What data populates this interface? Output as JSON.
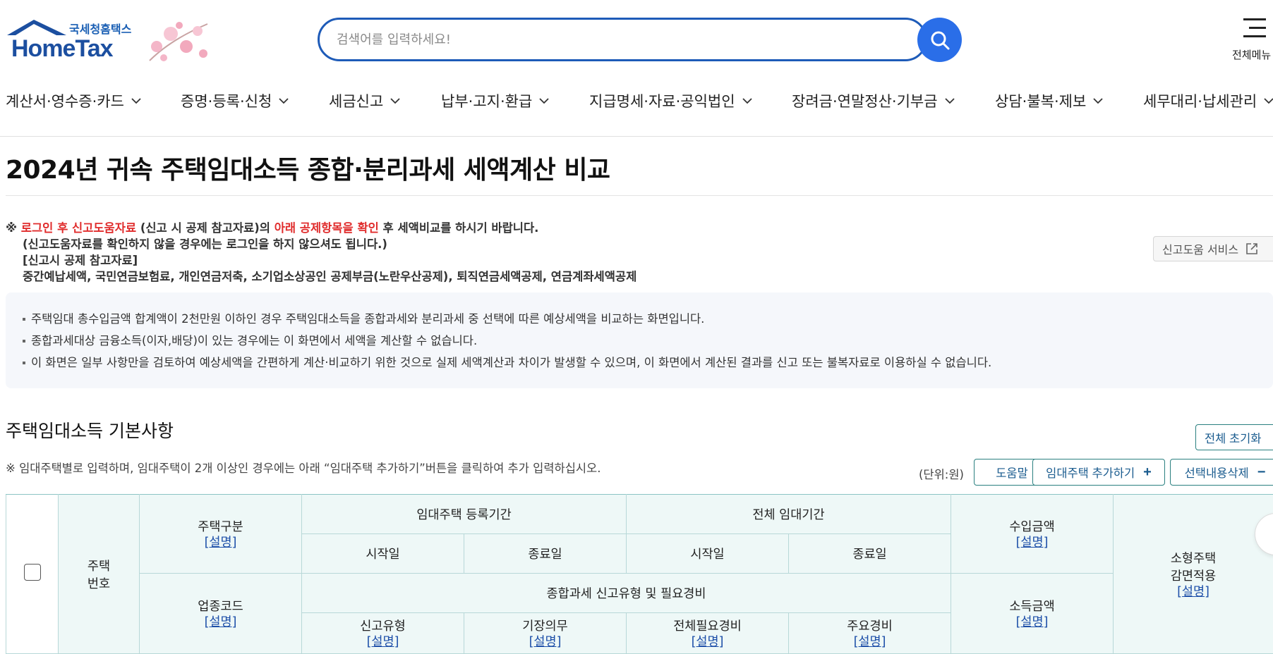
{
  "header": {
    "logo_sub": "국세청홈택스",
    "logo_main": "HomeTax",
    "search_placeholder": "검색어를 입력하세요!",
    "menu_label": "전체메뉴",
    "colors": {
      "brand": "#1c4fa0",
      "search_button": "#2a6ee8",
      "accent_red": "#e02c2c",
      "table_header_bg": "#eef8f7"
    }
  },
  "nav": {
    "items": [
      {
        "label": "계산서·영수증·카드"
      },
      {
        "label": "증명·등록·신청"
      },
      {
        "label": "세금신고"
      },
      {
        "label": "납부·고지·환급"
      },
      {
        "label": "지급명세·자료·공익법인"
      },
      {
        "label": "장려금·연말정산·기부금"
      },
      {
        "label": "상담·불복·제보"
      },
      {
        "label": "세무대리·납세관리"
      }
    ]
  },
  "page_title": "2024년 귀속 주택임대소득 종합·분리과세 세액계산 비교",
  "notice": {
    "mark": "※",
    "red1": "로그인 후 신고도움자료",
    "mid1": " (신고 시 공제 참고자료)의 ",
    "red2": "아래 공제항목을 확인",
    "end1": " 후 세액비교를 하시기 바랍니다.",
    "line2": "(신고도움자료를 확인하지 않을 경우에는 로그인을 하지 않으셔도 됩니다.)",
    "line3": "[신고시 공제 참고자료]",
    "line4": "중간예납세액, 국민연금보험료, 개인연금저축, 소기업소상공인 공제부금(노란우산공제), 퇴직연금세액공제, 연금계좌세액공제"
  },
  "help_service_label": "신고도움 서비스",
  "info_items": [
    "주택임대 총수입금액 합계액이 2천만원 이하인 경우 주택임대소득을 종합과세와 분리과세 중 선택에 따른 예상세액을 비교하는 화면입니다.",
    "종합과세대상 금융소득(이자,배당)이 있는 경우에는 이 화면에서 세액을 계산할 수 없습니다.",
    "이 화면은 일부 사항만을 검토하여 예상세액을 간편하게 계산·비교하기 위한 것으로 실제 세액계산과 차이가 발생할 수 있으며, 이 화면에서 계산된 결과를 신고 또는 불복자료로 이용하실 수 없습니다."
  ],
  "section": {
    "title": "주택임대소득 기본사항",
    "reset_label": "전체 초기화",
    "note": "※ 임대주택별로 입력하며, 임대주택이 2개 이상인 경우에는 아래 “임대주택 추가하기”버튼을 클릭하여 추가 입력하십시오.",
    "unit": "(단위:원)",
    "help_label": "도움말",
    "add_label": "임대주택 추가하기",
    "delete_label": "선택내용삭제"
  },
  "table": {
    "explain": "[설명]",
    "house_no": "주택\n번호",
    "house_type": "주택구분",
    "reg_period": "임대주택 등록기간",
    "total_period": "전체 임대기간",
    "start": "시작일",
    "end": "종료일",
    "income_amount": "수입금액",
    "small_house": "소형주택\n감면적용",
    "industry_code": "업종코드",
    "filing_type_header": "종합과세 신고유형 및 필요경비",
    "filing_type": "신고유형",
    "bookkeeping": "기장의무",
    "total_expense": "전체필요경비",
    "main_expense": "주요경비",
    "earned_amount": "소득금액"
  }
}
